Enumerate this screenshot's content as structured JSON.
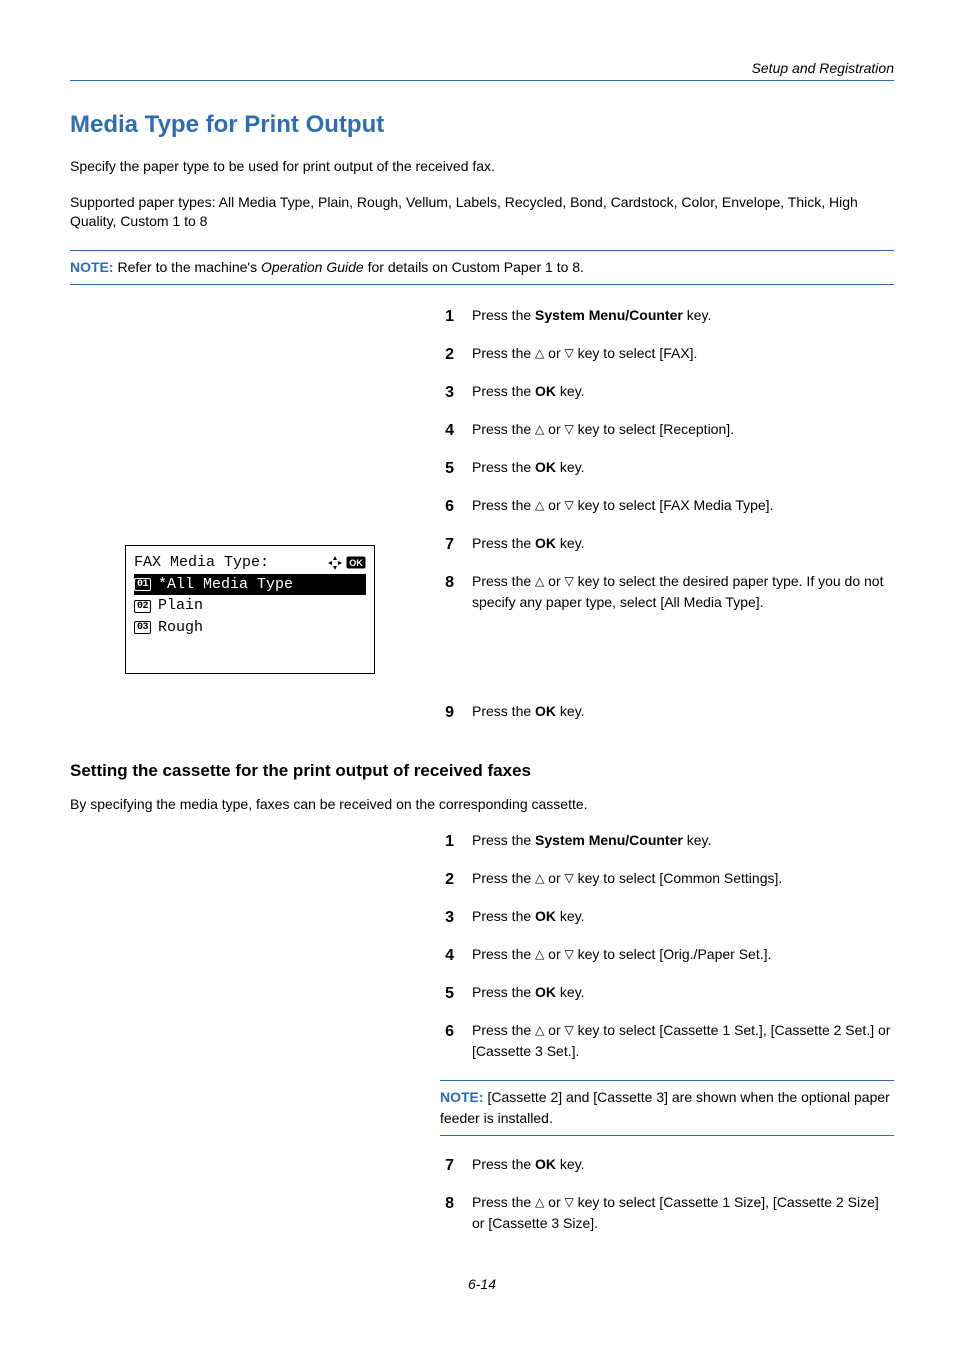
{
  "header": {
    "section": "Setup and Registration"
  },
  "title": "Media Type for Print Output",
  "intro1": "Specify the paper type to be used for print output of the received fax.",
  "intro2": "Supported paper types: All Media Type, Plain, Rough, Vellum, Labels, Recycled, Bond, Cardstock, Color, Envelope, Thick, High Quality, Custom 1 to 8",
  "note1": {
    "label": "NOTE:",
    "before": "Refer to the machine's ",
    "italic": "Operation Guide",
    "after": " for details on Custom Paper 1 to 8."
  },
  "lcd": {
    "title": "FAX Media Type:",
    "items": [
      {
        "num": "01",
        "text": "*All Media Type",
        "selected": true
      },
      {
        "num": "02",
        "text": "Plain",
        "selected": false
      },
      {
        "num": "03",
        "text": "Rough",
        "selected": false
      }
    ]
  },
  "steps1": [
    {
      "n": "1",
      "pre": "Press the ",
      "bold": "System Menu/Counter",
      "post": " key."
    },
    {
      "n": "2",
      "pre": "Press the ",
      "tri": true,
      "post": " key to select [FAX]."
    },
    {
      "n": "3",
      "pre": "Press the ",
      "bold": "OK",
      "post": " key."
    },
    {
      "n": "4",
      "pre": "Press the ",
      "tri": true,
      "post": " key to select [Reception]."
    },
    {
      "n": "5",
      "pre": "Press the ",
      "bold": "OK",
      "post": " key."
    },
    {
      "n": "6",
      "pre": "Press the ",
      "tri": true,
      "post": " key to select [FAX Media Type]."
    },
    {
      "n": "7",
      "pre": "Press the ",
      "bold": "OK",
      "post": " key."
    },
    {
      "n": "8",
      "pre": "Press the ",
      "tri": true,
      "post": " key to select the desired paper type. If you do not specify any paper type, select [All Media Type]."
    },
    {
      "n": "9",
      "pre": "Press the ",
      "bold": "OK",
      "post": " key."
    }
  ],
  "sub_heading": "Setting the cassette for the print output of received faxes",
  "sub_intro": "By specifying the media type, faxes can be received on the corresponding cassette.",
  "steps2a": [
    {
      "n": "1",
      "pre": "Press the ",
      "bold": "System Menu/Counter",
      "post": " key."
    },
    {
      "n": "2",
      "pre": "Press the ",
      "tri": true,
      "post": " key to select [Common Settings]."
    },
    {
      "n": "3",
      "pre": "Press the ",
      "bold": "OK",
      "post": " key."
    },
    {
      "n": "4",
      "pre": "Press the ",
      "tri": true,
      "post": " key to select [Orig./Paper Set.]."
    },
    {
      "n": "5",
      "pre": "Press the ",
      "bold": "OK",
      "post": " key."
    },
    {
      "n": "6",
      "pre": "Press the ",
      "tri": true,
      "post": " key to select [Cassette 1 Set.], [Cassette 2 Set.] or [Cassette 3 Set.]."
    }
  ],
  "note2": {
    "label": "NOTE:",
    "text": " [Cassette 2] and [Cassette 3] are shown when the optional paper feeder is installed."
  },
  "steps2b": [
    {
      "n": "7",
      "pre": "Press the ",
      "bold": "OK",
      "post": " key."
    },
    {
      "n": "8",
      "pre": "Press the ",
      "tri": true,
      "post": " key to select [Cassette 1 Size], [Cassette 2 Size] or [Cassette 3 Size]."
    }
  ],
  "footer": "6-14"
}
